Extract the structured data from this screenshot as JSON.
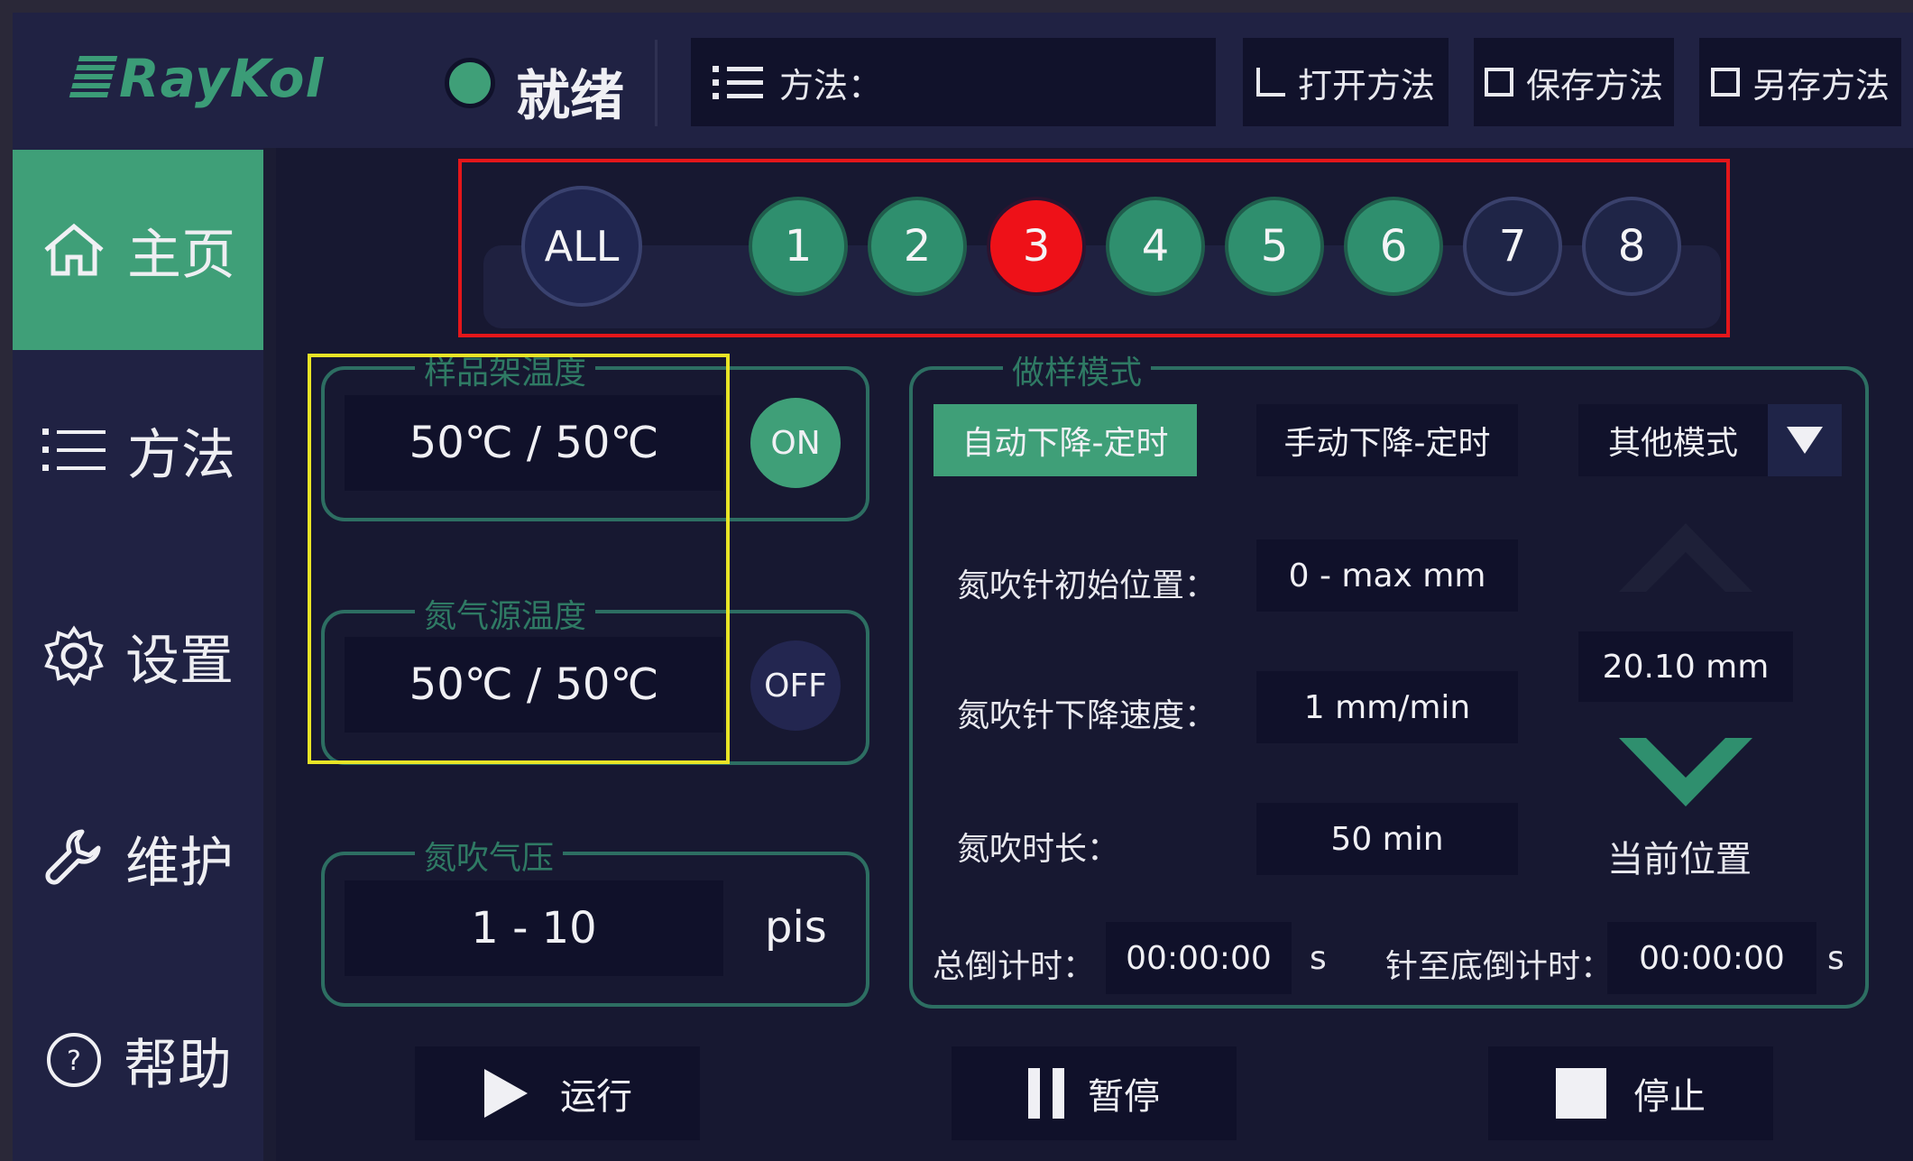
{
  "header": {
    "logo_text": "RayKol",
    "status_text": "就绪",
    "status_color": "#3f9f78",
    "method_label": "方法：",
    "buttons": {
      "open": "打开方法",
      "save": "保存方法",
      "save_as": "另存方法"
    }
  },
  "sidebar": {
    "items": [
      {
        "label": "主页",
        "icon": "home-icon",
        "active": true
      },
      {
        "label": "方法",
        "icon": "list-icon",
        "active": false
      },
      {
        "label": "设置",
        "icon": "gear-icon",
        "active": false
      },
      {
        "label": "维护",
        "icon": "wrench-icon",
        "active": false
      },
      {
        "label": "帮助",
        "icon": "help-icon",
        "active": false
      }
    ]
  },
  "channels": {
    "all_label": "ALL",
    "items": [
      {
        "label": "1",
        "state": "green"
      },
      {
        "label": "2",
        "state": "green"
      },
      {
        "label": "3",
        "state": "red"
      },
      {
        "label": "4",
        "state": "green"
      },
      {
        "label": "5",
        "state": "green"
      },
      {
        "label": "6",
        "state": "green"
      },
      {
        "label": "7",
        "state": "dark"
      },
      {
        "label": "8",
        "state": "dark"
      }
    ]
  },
  "sample_rack_temp": {
    "title": "样品架温度",
    "value": "50℃ / 50℃",
    "toggle": "ON"
  },
  "nitrogen_source_temp": {
    "title": "氮气源温度",
    "value": "50℃ / 50℃",
    "toggle": "OFF"
  },
  "nitrogen_pressure": {
    "title": "氮吹气压",
    "value": "1 - 10",
    "unit": "pis"
  },
  "sampling_mode": {
    "title": "做样模式",
    "mode_buttons": [
      "自动下降-定时",
      "手动下降-定时"
    ],
    "other_mode": "其他模式",
    "params": [
      {
        "label": "氮吹针初始位置：",
        "value": "0 - max mm"
      },
      {
        "label": "氮吹针下降速度：",
        "value": "1 mm/min"
      },
      {
        "label": "氮吹时长：",
        "value": "50 min"
      }
    ],
    "current_position_value": "20.10 mm",
    "current_position_label": "当前位置",
    "total_countdown_label": "总倒计时：",
    "total_countdown_value": "00:00:00",
    "total_countdown_unit": "s",
    "needle_countdown_label": "针至底倒计时：",
    "needle_countdown_value": "00:00:00",
    "needle_countdown_unit": "s"
  },
  "actions": {
    "run": "运行",
    "pause": "暂停",
    "stop": "停止"
  }
}
